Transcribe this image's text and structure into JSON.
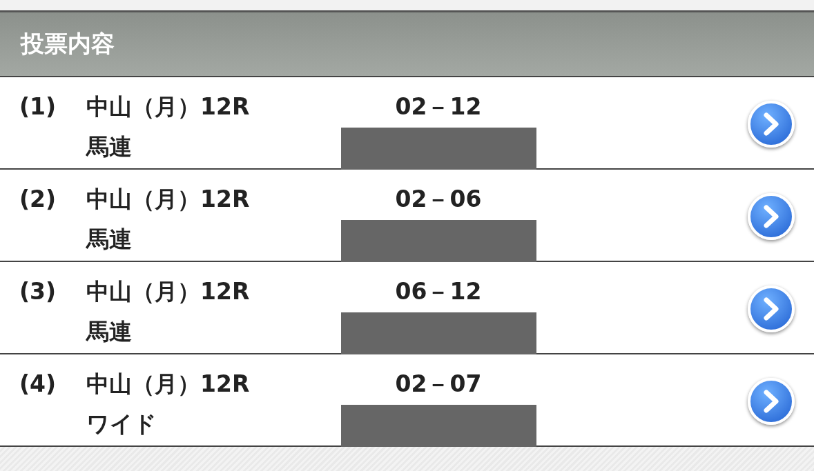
{
  "header": {
    "title": "投票内容"
  },
  "bets": [
    {
      "number": "(1)",
      "race": "中山（月）12R",
      "type": "馬連",
      "combination": "02－12"
    },
    {
      "number": "(2)",
      "race": "中山（月）12R",
      "type": "馬連",
      "combination": "02－06"
    },
    {
      "number": "(3)",
      "race": "中山（月）12R",
      "type": "馬連",
      "combination": "06－12"
    },
    {
      "number": "(4)",
      "race": "中山（月）12R",
      "type": "ワイド",
      "combination": "02－07"
    }
  ]
}
